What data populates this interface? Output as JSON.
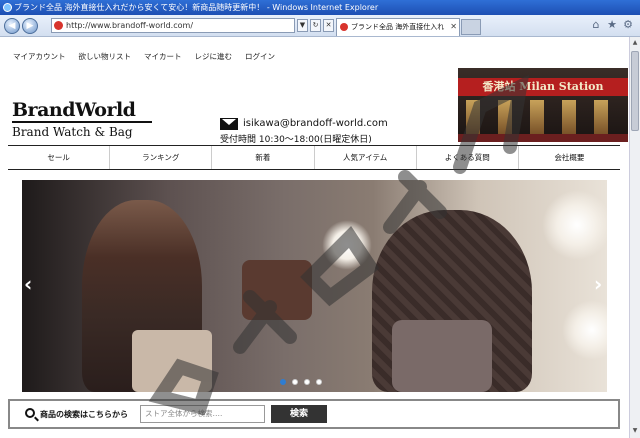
{
  "browser": {
    "window_title": "ブランド全品 海外直接仕入れだから安くて安心！新商品随時更新中！ - Windows Internet Explorer",
    "url": "http://www.brandoff-world.com/",
    "tab_title": "ブランド全品 海外直接仕入れ",
    "back_glyph": "◀",
    "forward_glyph": "▶",
    "dropdown_glyph": "▼",
    "refresh_glyph": "↻",
    "close_glyph": "✕",
    "home_glyph": "⌂",
    "star_glyph": "★",
    "gear_glyph": "⚙"
  },
  "site": {
    "top_nav": [
      "マイアカウント",
      "欲しい物リスト",
      "マイカート",
      "レジに進む",
      "ログイン"
    ],
    "logo_main": "BrandWorld",
    "logo_sub": "Brand Watch & Bag",
    "email": "isikawa@brandoff-world.com",
    "hours": "受付時間  10:30～18:00(日曜定休日)",
    "storefront_sign": "香港站 Milan Station",
    "categories": [
      "セール",
      "ランキング",
      "新着",
      "人気アイテム",
      "よくある質問",
      "会社概要"
    ],
    "hero_prev": "‹",
    "hero_next": "›",
    "hero_slide_count": 4,
    "hero_active_slide": 1,
    "search_label": "商品の検索はこちらから",
    "search_placeholder": "ストア全体から検索….",
    "search_button": "検索"
  },
  "colors": {
    "titlebar": "#1d4fb3",
    "search_button": "#333333",
    "active_dot": "#2f7dd1"
  }
}
